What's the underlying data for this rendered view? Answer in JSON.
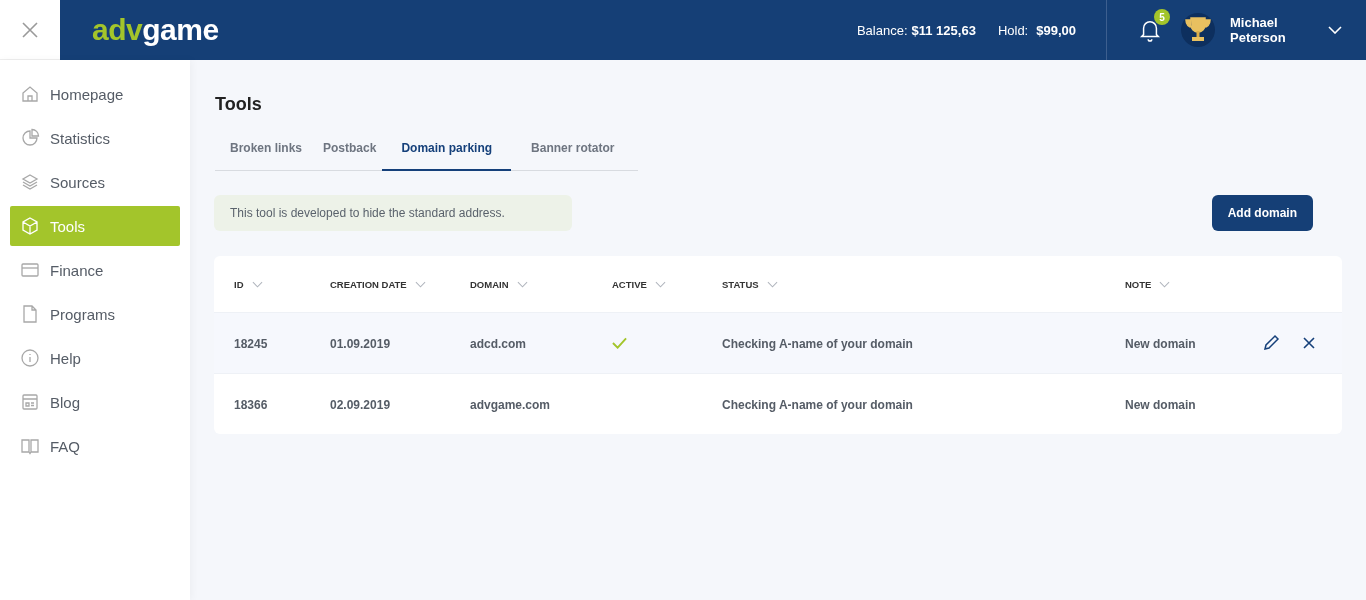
{
  "logo": {
    "part_1": "adv",
    "part_2": "game"
  },
  "header": {
    "balance_label": "Balance:",
    "balance_value": "$11 125,63",
    "hold_label": "Hold:",
    "hold_value": "$99,00",
    "notification_count": "5",
    "user_name": "Michael Peterson"
  },
  "sidebar": {
    "items": [
      {
        "label": "Homepage",
        "selected": false
      },
      {
        "label": "Statistics",
        "selected": false
      },
      {
        "label": "Sources",
        "selected": false
      },
      {
        "label": "Tools",
        "selected": true
      },
      {
        "label": "Finance",
        "selected": false
      },
      {
        "label": "Programs",
        "selected": false
      },
      {
        "label": "Help",
        "selected": false
      },
      {
        "label": "Blog",
        "selected": false
      },
      {
        "label": "FAQ",
        "selected": false
      }
    ]
  },
  "page": {
    "title": "Tools",
    "tabs": [
      {
        "label": "Broken links",
        "selected": false
      },
      {
        "label": "Postback",
        "selected": false
      },
      {
        "label": "Domain parking",
        "selected": true
      },
      {
        "label": "Banner rotator",
        "selected": false
      }
    ],
    "info": "This tool is developed to hide the standard address.",
    "add_button": "Add domain"
  },
  "table": {
    "columns": [
      "ID",
      "CREATION DATE",
      "DOMAIN",
      "ACTIVE",
      "STATUS",
      "NOTE"
    ],
    "rows": [
      {
        "id": "18245",
        "date": "01.09.2019",
        "domain": "adcd.com",
        "active": true,
        "status": "Checking A-name of your domain",
        "note": "New domain",
        "selected": true
      },
      {
        "id": "18366",
        "date": "02.09.2019",
        "domain": "advgame.com",
        "active": false,
        "status": "Checking A-name of your domain",
        "note": "New domain",
        "selected": false
      }
    ]
  }
}
